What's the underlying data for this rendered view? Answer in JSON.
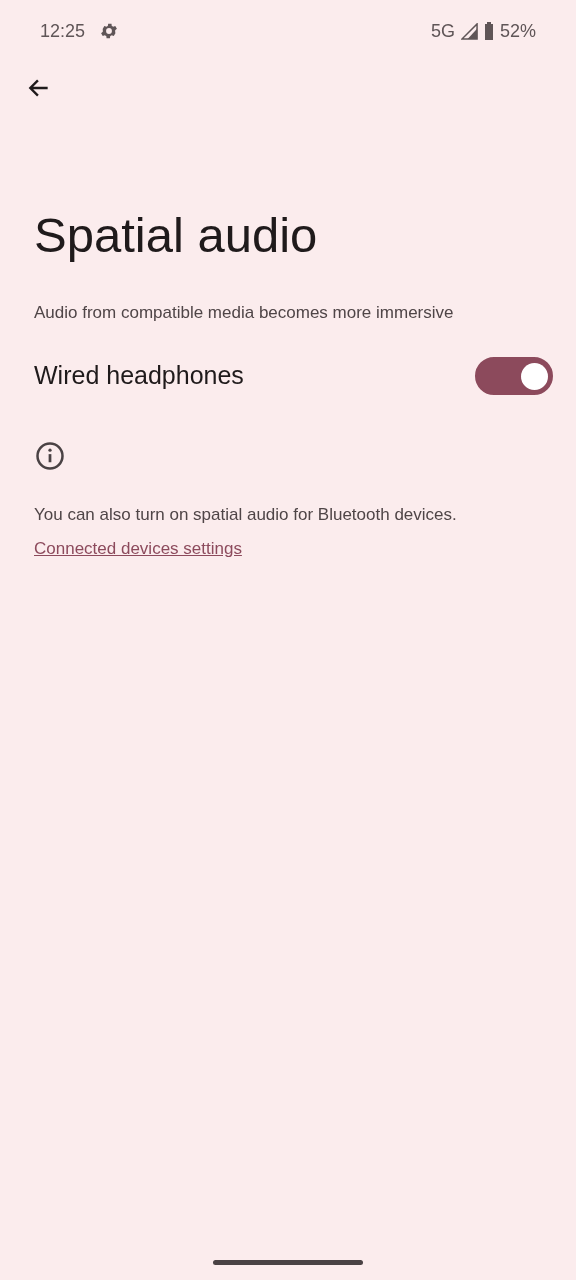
{
  "status_bar": {
    "time": "12:25",
    "network": "5G",
    "battery": "52%"
  },
  "title": "Spatial audio",
  "description": "Audio from compatible media becomes more immersive",
  "settings": [
    {
      "kind": "switch",
      "label": "Wired headphones",
      "on": true
    }
  ],
  "footer": {
    "text": "You can also turn on spatial audio for Bluetooth devices.",
    "link": "Connected devices settings"
  }
}
